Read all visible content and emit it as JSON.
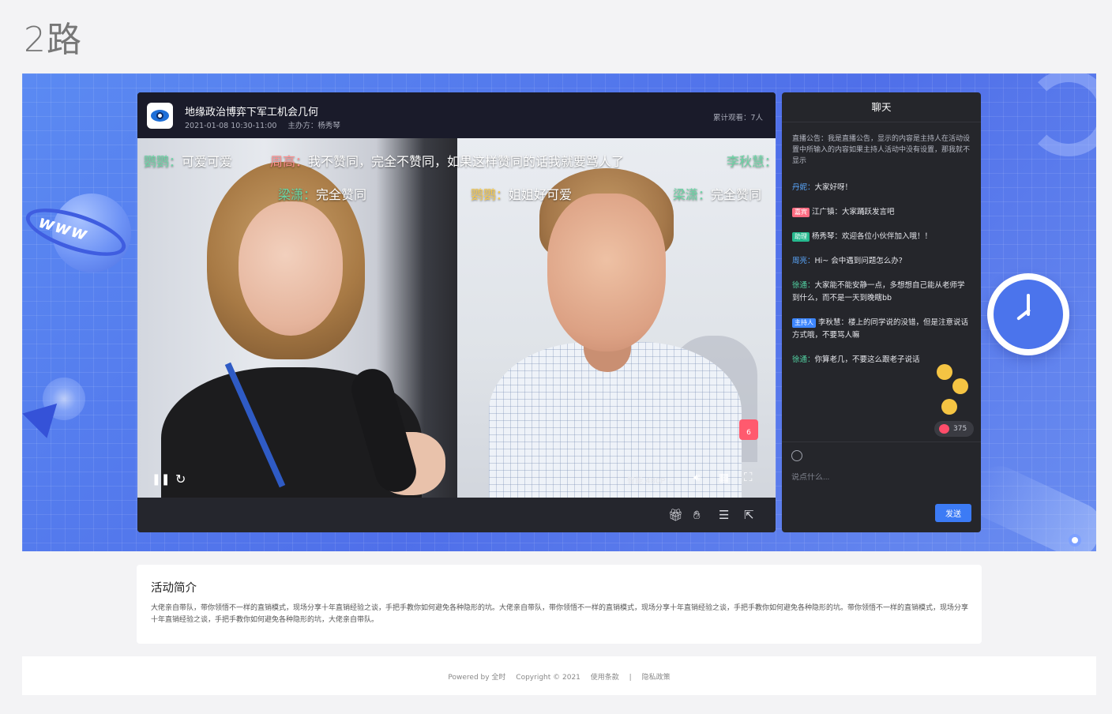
{
  "page_label": "2路",
  "player": {
    "event_title": "地缘政治博弈下军工机会几何",
    "event_time": "2021-01-08 10:30-11:00",
    "host_label": "主办方：杨秀琴",
    "view_count": "累计观看：7人",
    "quality_label": "智能 480P",
    "live_badge_count": "6"
  },
  "danmaku": [
    {
      "name": "鹦鹦：",
      "text": "可爱可爱"
    },
    {
      "name": "周高：",
      "text": "我不赞同，完全不赞同，如果这样赞同的话我就要骂人了"
    },
    {
      "name": "李秋慧：",
      "text": ""
    },
    {
      "name": "梁潇：",
      "text": "完全赞同"
    },
    {
      "name": "鹦鹦：",
      "text": "姐姐好可爱"
    },
    {
      "name": "梁潇：",
      "text": "完全赞同"
    }
  ],
  "chat": {
    "title": "聊天",
    "notice": "直播公告：我是直播公告，显示的内容是主持人在活动设置中所输入的内容如果主持人活动中没有设置，那我就不显示",
    "messages": [
      {
        "tag": "",
        "name": "丹妮：",
        "text": "大家好呀！"
      },
      {
        "tag": "嘉宾",
        "name": "江广镇：",
        "text": "大家踊跃发言吧"
      },
      {
        "tag": "助理",
        "name": "杨秀琴：",
        "text": "欢迎各位小伙伴加入哦！！"
      },
      {
        "tag": "",
        "name": "周亮：",
        "text": "Hi~ 会中遇到问题怎么办?"
      },
      {
        "tag": "",
        "name": "徐通：",
        "text": "大家能不能安静一点，多想想自己能从老师学到什么，而不是一天到晚瞎bb"
      },
      {
        "tag": "主持人",
        "name": "李秋慧：",
        "text": "楼上的同学说的没错，但是注意说话方式哦，不要骂人嘛"
      },
      {
        "tag": "",
        "name": "徐通：",
        "text": "你算老几，不要这么跟老子说话"
      }
    ],
    "like_count": "375",
    "input_placeholder": "说点什么...",
    "send_label": "发送"
  },
  "intro": {
    "title": "活动简介",
    "text": "大佬亲自带队，带你领悟不一样的直销模式，现场分享十年直销经验之谈，手把手教你如何避免各种隐形的坑。大佬亲自带队，带你领悟不一样的直销模式，现场分享十年直销经验之谈，手把手教你如何避免各种隐形的坑。带你领悟不一样的直销模式，现场分享十年直销经验之谈，手把手教你如何避免各种隐形的坑，大佬亲自带队。"
  },
  "footer": {
    "powered": "Powered by 全时",
    "copyright": "Copyright © 2021",
    "terms": "使用条款",
    "separator": "|",
    "privacy": "隐私政策"
  },
  "colors": {
    "stage_blue": "#5b82ef",
    "send_blue": "#3c7bf5",
    "tag_guest": "#ff6b81",
    "tag_assist": "#26b98f",
    "tag_host": "#3d86ff"
  }
}
